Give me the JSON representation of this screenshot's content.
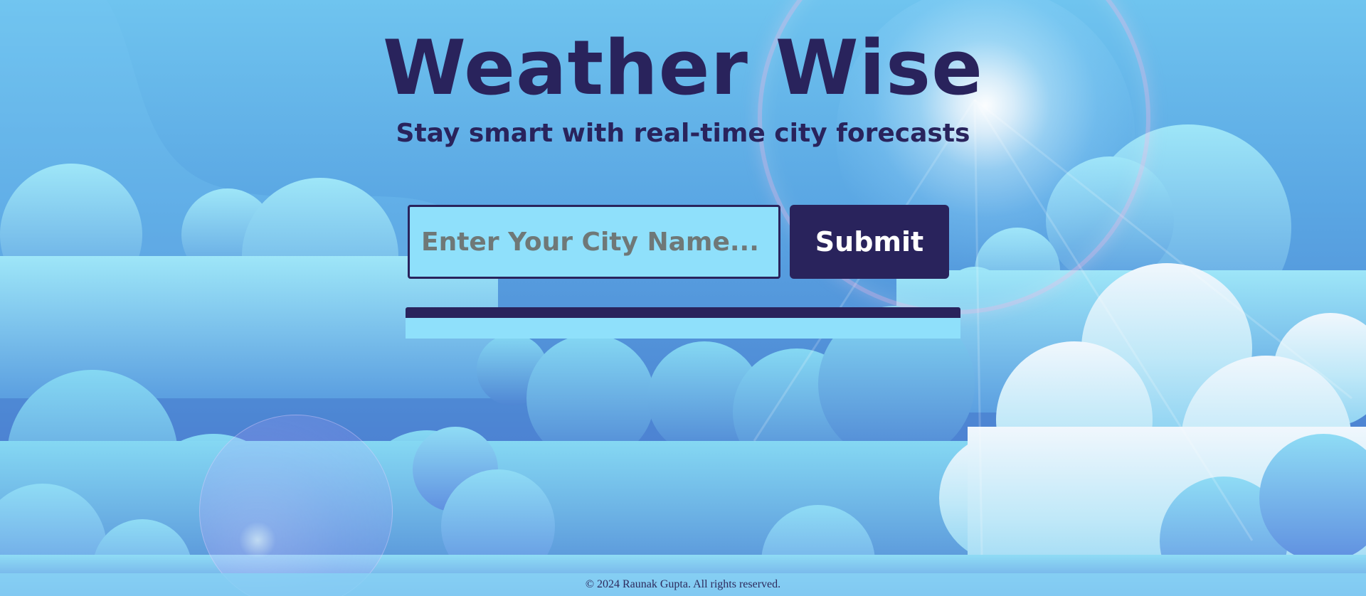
{
  "header": {
    "title": "Weather Wise",
    "subtitle": "Stay smart with real-time city forecasts"
  },
  "search": {
    "placeholder": "Enter Your City Name...",
    "value": "",
    "submit_label": "Submit"
  },
  "footer": {
    "text": "© 2024 Raunak Gupta. All rights reserved."
  },
  "colors": {
    "primary": "#29235c",
    "input_bg": "#8fe0fb",
    "placeholder": "#6f7877"
  }
}
